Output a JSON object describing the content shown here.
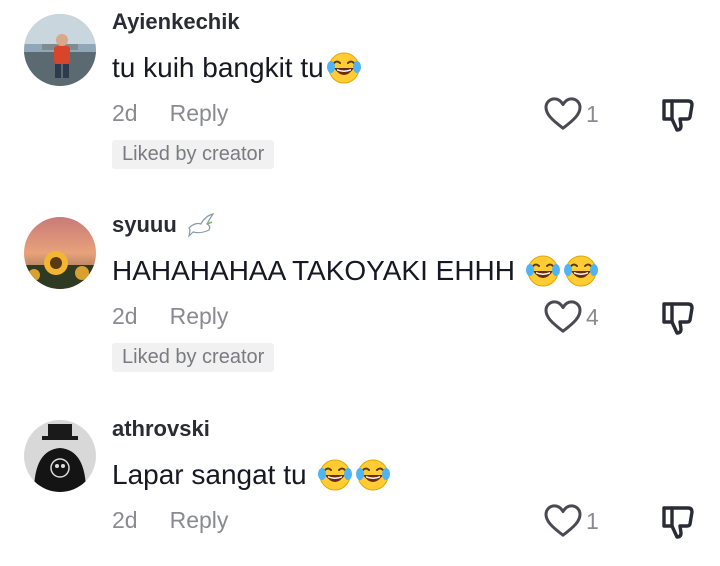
{
  "comments": [
    {
      "username": "Ayienkechik",
      "text": "tu kuih bangkit tu",
      "emojis": [
        "laugh-cry"
      ],
      "age": "2d",
      "reply_label": "Reply",
      "likes": "1",
      "liked_by_creator": "Liked by creator"
    },
    {
      "username": "syuuu",
      "username_icon": "dove-icon",
      "text": "HAHAHAHAA TAKOYAKI EHHH",
      "emojis": [
        "laugh-cry",
        "laugh-cry"
      ],
      "age": "2d",
      "reply_label": "Reply",
      "likes": "4",
      "liked_by_creator": "Liked by creator"
    },
    {
      "username": "athrovski",
      "text": "Lapar sangat tu",
      "emojis": [
        "laugh-cry",
        "laugh-cry"
      ],
      "age": "2d",
      "reply_label": "Reply",
      "likes": "1"
    }
  ],
  "icons": {
    "like": "heart-outline-icon",
    "dislike": "thumbs-down-outline-icon"
  }
}
